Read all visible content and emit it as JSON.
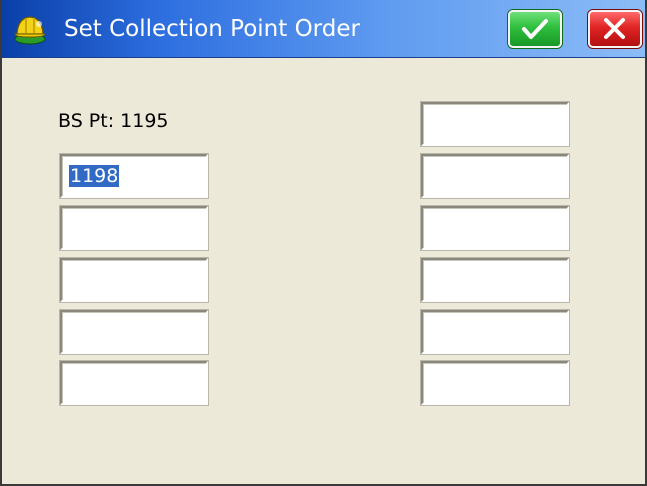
{
  "window": {
    "title": "Set Collection Point Order",
    "icons": {
      "app": "hardhat-icon",
      "ok": "check-icon",
      "cancel": "close-icon"
    },
    "colors": {
      "titlebar_start": "#0a3fa8",
      "titlebar_end": "#8cbcf7",
      "ok": "#2fbf3d",
      "cancel": "#e02424",
      "background": "#ece9d8",
      "selection": "#316ac5"
    }
  },
  "form": {
    "bs_label": "BS Pt: 1195",
    "left_fields": [
      {
        "value": "1198"
      },
      {
        "value": ""
      },
      {
        "value": ""
      },
      {
        "value": ""
      },
      {
        "value": ""
      }
    ],
    "right_fields": [
      {
        "value": ""
      },
      {
        "value": ""
      },
      {
        "value": ""
      },
      {
        "value": ""
      },
      {
        "value": ""
      },
      {
        "value": ""
      }
    ]
  }
}
